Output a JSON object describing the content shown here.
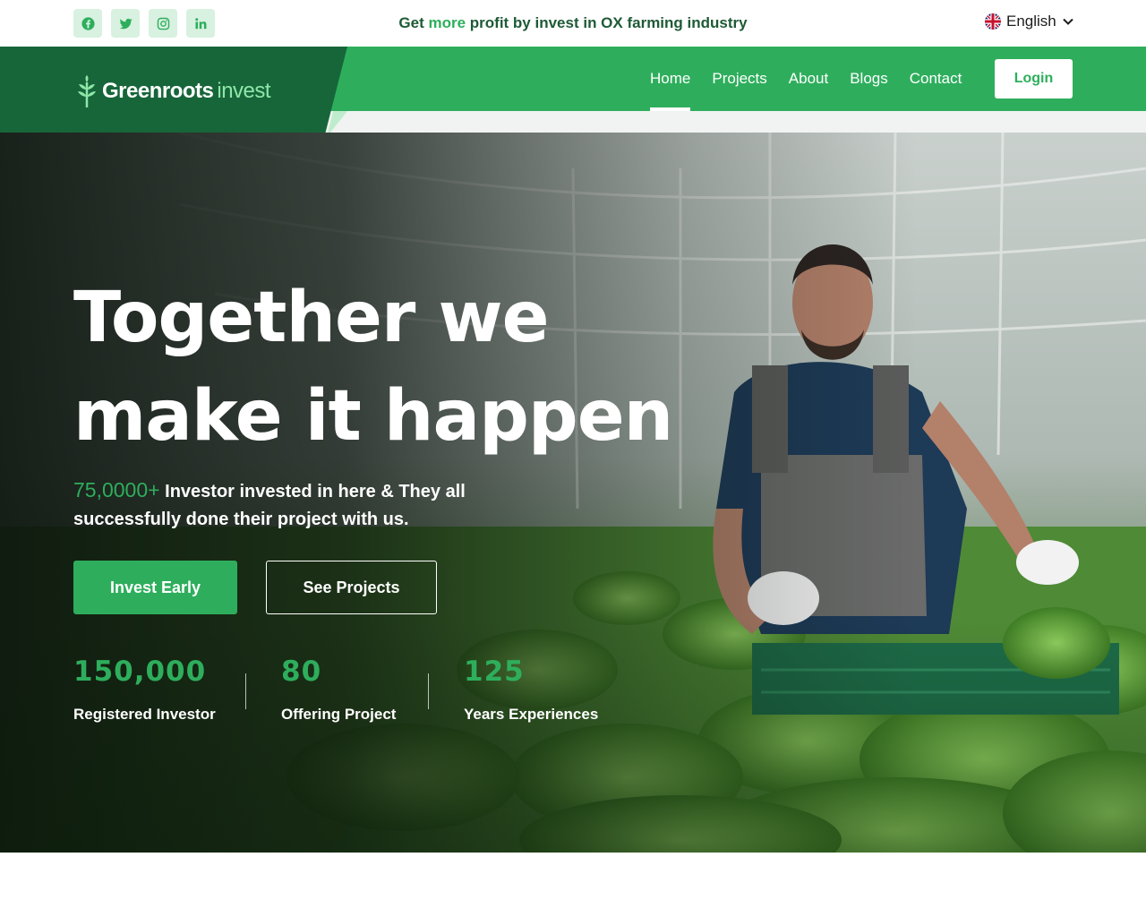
{
  "topbar": {
    "socials": [
      {
        "icon": "facebook-icon"
      },
      {
        "icon": "twitter-icon"
      },
      {
        "icon": "instagram-icon"
      },
      {
        "icon": "linkedin-icon"
      }
    ],
    "tagline": {
      "before": "Get ",
      "highlight": "more",
      "after": " profit by invest in OX farming industry"
    },
    "language": {
      "label": "English",
      "flag": "uk-flag-icon"
    }
  },
  "nav": {
    "logo": {
      "word1": "Greenroots",
      "word2": "invest"
    },
    "items": [
      {
        "label": "Home",
        "active": true
      },
      {
        "label": "Projects"
      },
      {
        "label": "About"
      },
      {
        "label": "Blogs"
      },
      {
        "label": "Contact"
      }
    ],
    "login_label": "Login"
  },
  "hero": {
    "headline_line1": "Together we",
    "headline_line2": "make it happen",
    "intro_number": "75,0000+",
    "intro_text": " Investor invested in here & They all successfully done their project with us.",
    "primary_cta": "Invest Early",
    "secondary_cta": "See Projects",
    "stats": [
      {
        "value": "150,000",
        "label": "Registered Investor"
      },
      {
        "value": "80",
        "label": "Offering Project"
      },
      {
        "value": "125",
        "label": "Years Experiences"
      }
    ]
  },
  "colors": {
    "accent": "#2eae5c",
    "dark_green": "#17663a",
    "nav_green": "#2eae5c"
  }
}
